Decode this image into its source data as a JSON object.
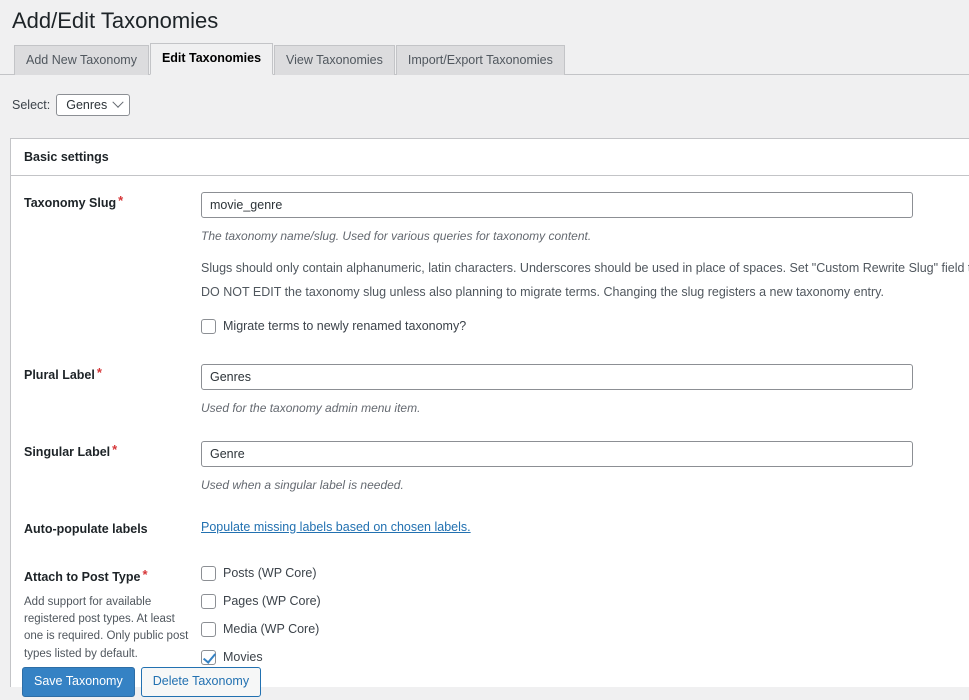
{
  "page": {
    "title": "Add/Edit Taxonomies"
  },
  "tabs": [
    {
      "label": "Add New Taxonomy",
      "active": false
    },
    {
      "label": "Edit Taxonomies",
      "active": true
    },
    {
      "label": "View Taxonomies",
      "active": false
    },
    {
      "label": "Import/Export Taxonomies",
      "active": false
    }
  ],
  "selector": {
    "label": "Select:",
    "value": "Genres",
    "icon": "chevron-down-icon"
  },
  "card": {
    "heading": "Basic settings"
  },
  "fields": {
    "slug": {
      "label": "Taxonomy Slug",
      "required_mark": "*",
      "value": "movie_genre",
      "placeholder": "",
      "hint": "The taxonomy name/slug. Used for various queries for taxonomy content.",
      "note_1": "Slugs should only contain alphanumeric, latin characters. Underscores should be used in place of spaces. Set \"Custom Rewrite Slug\" field to make slug use dashes for URLs.",
      "note_2": "DO NOT EDIT the taxonomy slug unless also planning to migrate terms. Changing the slug registers a new taxonomy entry.",
      "migrate_label": "Migrate terms to newly renamed taxonomy?",
      "migrate_checked": false
    },
    "plural": {
      "label": "Plural Label",
      "required_mark": "*",
      "value": "Genres",
      "placeholder": "",
      "hint": "Used for the taxonomy admin menu item."
    },
    "singular": {
      "label": "Singular Label",
      "required_mark": "*",
      "value": "Genre",
      "placeholder": "",
      "hint": "Used when a singular label is needed."
    },
    "autopopulate": {
      "label": "Auto-populate labels",
      "link_text": "Populate missing labels based on chosen labels."
    },
    "attach": {
      "label": "Attach to Post Type",
      "required_mark": "*",
      "description": "Add support for available registered post types. At least one is required. Only public post types listed by default.",
      "options": [
        {
          "label": "Posts (WP Core)",
          "checked": false
        },
        {
          "label": "Pages (WP Core)",
          "checked": false
        },
        {
          "label": "Media (WP Core)",
          "checked": false
        },
        {
          "label": "Movies",
          "checked": true
        }
      ]
    }
  },
  "buttons": {
    "save": "Save Taxonomy",
    "delete": "Delete Taxonomy"
  },
  "colors": {
    "accent": "#3582c4",
    "link": "#2271b1",
    "required": "#d63638",
    "page_bg": "#f0f0f1",
    "card_bg": "#ffffff",
    "border": "#c3c4c7"
  }
}
